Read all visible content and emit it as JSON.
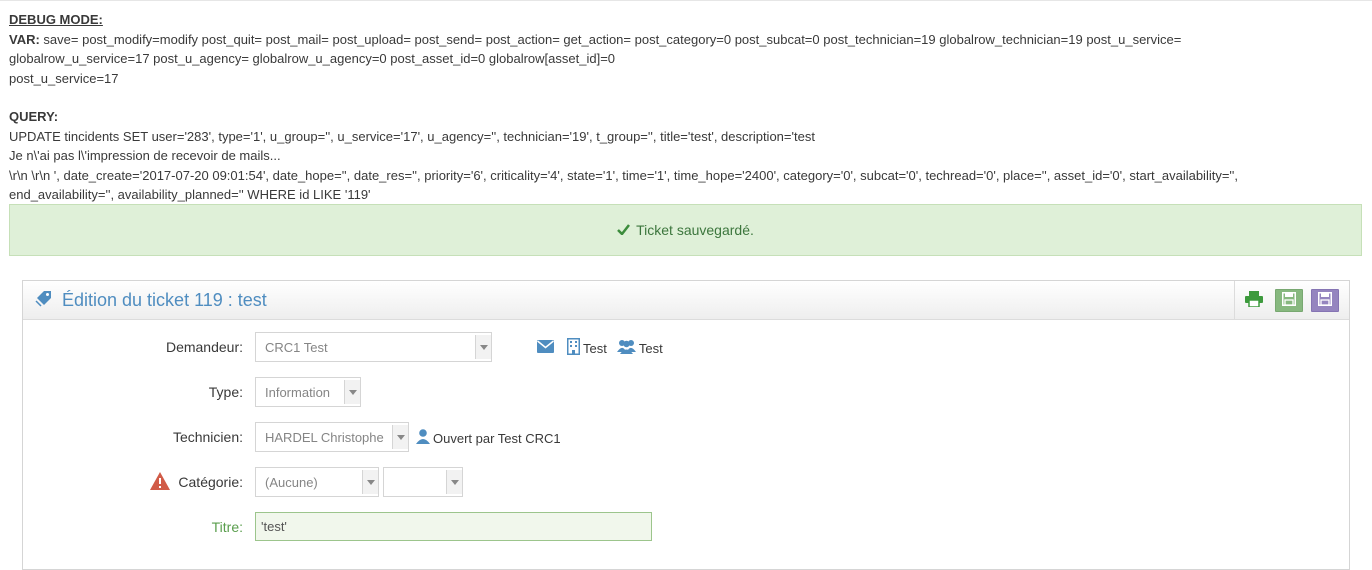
{
  "debug": {
    "title": "DEBUG MODE:",
    "var_label": "VAR:",
    "var_line1": " save= post_modify=modify post_quit= post_mail= post_upload= post_send= post_action= get_action= post_category=0 post_subcat=0 post_technician=19 globalrow_technician=19 post_u_service=",
    "var_line2": "globalrow_u_service=17 post_u_agency= globalrow_u_agency=0 post_asset_id=0 globalrow[asset_id]=0",
    "var_line3": "post_u_service=17",
    "query_label": "QUERY:",
    "query_line1": "UPDATE tincidents SET user='283', type='1', u_group='', u_service='17', u_agency='', technician='19', t_group='', title='test', description='test",
    "query_line2": "Je n\\'ai pas l\\'impression de recevoir de mails...",
    "query_line3": "\\r\\n \\r\\n ', date_create='2017-07-20 09:01:54', date_hope='', date_res='', priority='6', criticality='4', state='1', time='1', time_hope='2400', category='0', subcat='0', techread='0', place='', asset_id='0', start_availability='',",
    "query_line4": "end_availability='', availability_planned='' WHERE id LIKE '119'"
  },
  "alert": {
    "message": "Ticket sauvegardé."
  },
  "widget": {
    "title": "Édition du ticket 119 : test",
    "colors": {
      "title": "#4f8dc0",
      "save": "#87b87f",
      "save_quit": "#9585bf",
      "print": "#3d9a3d"
    }
  },
  "form": {
    "demandeur": {
      "label": "Demandeur:",
      "value": "CRC1 Test",
      "service": "Test",
      "group": "Test"
    },
    "type": {
      "label": "Type:",
      "value": "Information"
    },
    "technicien": {
      "label": "Technicien:",
      "value": "HARDEL Christophe",
      "opened_by": "Ouvert par Test CRC1"
    },
    "categorie": {
      "label": "Catégorie:",
      "value": "(Aucune)",
      "subcat_value": ""
    },
    "titre": {
      "label": "Titre:",
      "value": "'test'"
    }
  },
  "icons": [
    "tag-icon",
    "print-icon",
    "save-icon",
    "save-quit-icon",
    "envelope-icon",
    "building-icon",
    "users-icon",
    "user-icon",
    "warning-icon",
    "check-icon"
  ]
}
